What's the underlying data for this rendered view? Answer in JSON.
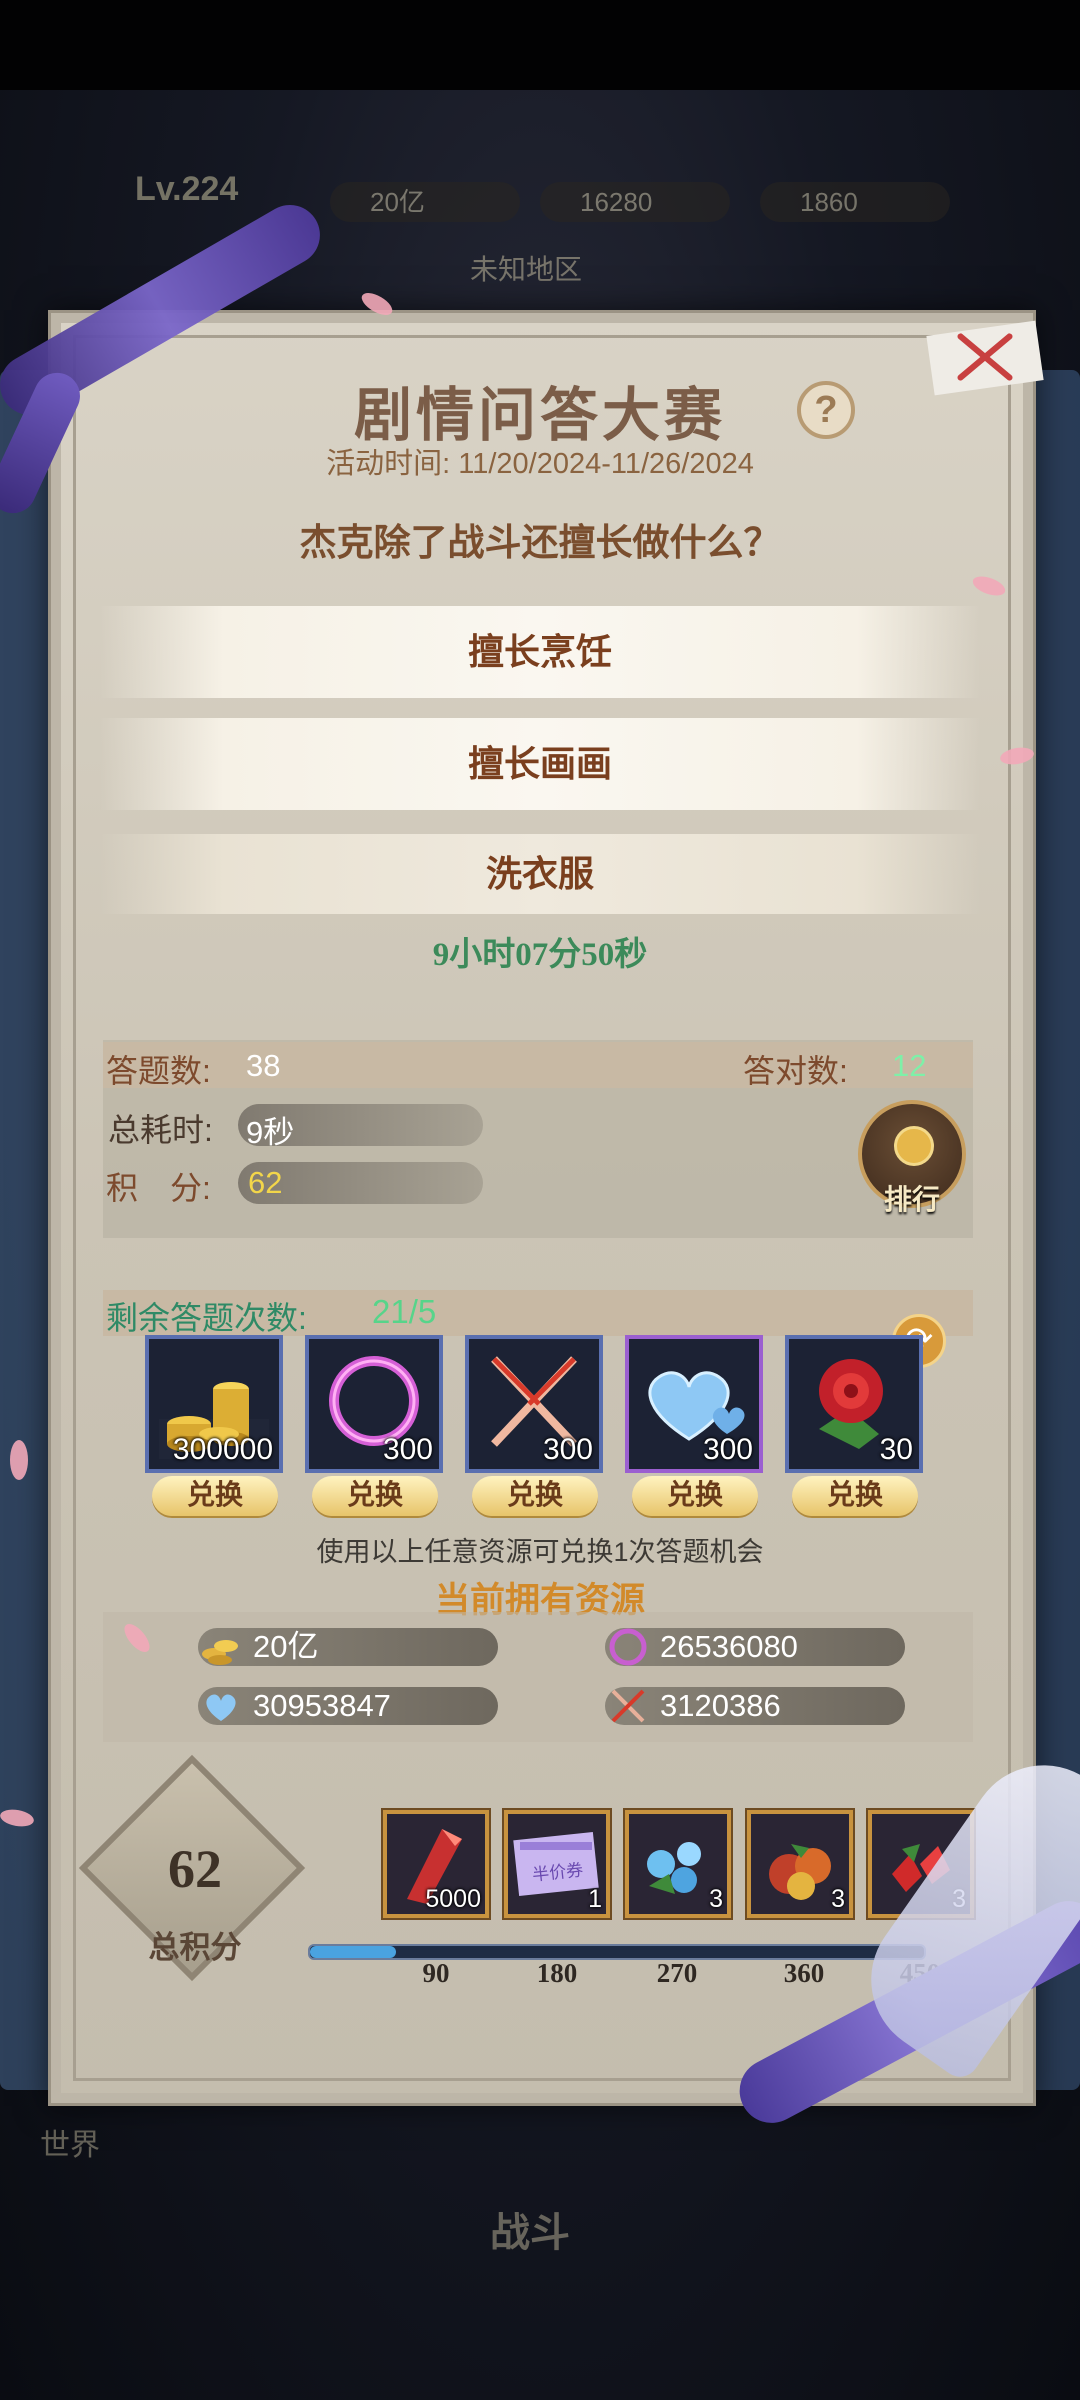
{
  "background_hud": {
    "level": "Lv.224",
    "gold": "20亿",
    "diamond": "16280",
    "energy": "1860",
    "area": "未知地区",
    "chat_tab": "世界",
    "bottom_center": "战斗"
  },
  "dialog": {
    "title": "剧情问答大赛",
    "help_symbol": "?",
    "activity_time": "活动时间: 11/20/2024-11/26/2024",
    "question": "杰克除了战斗还擅长做什么？",
    "options": [
      "擅长烹饪",
      "擅长画画",
      "洗衣服"
    ],
    "countdown": "9小时07分50秒"
  },
  "stats": {
    "answered_label": "答题数:",
    "answered_value": "38",
    "correct_label": "答对数:",
    "correct_value": "12",
    "time_label": "总耗时:",
    "time_value": "9秒",
    "score_label": "积　分:",
    "score_value": "62",
    "rank_label": "排行"
  },
  "remaining": {
    "label": "剩余答题次数:",
    "value": "21/5"
  },
  "exchange_items": [
    {
      "icon": "gold-coins-icon",
      "qty": "300000",
      "button": "兑换"
    },
    {
      "icon": "purple-ring-icon",
      "qty": "300",
      "button": "兑换"
    },
    {
      "icon": "crossed-swords-icon",
      "qty": "300",
      "button": "兑换"
    },
    {
      "icon": "blue-heart-crystal-icon",
      "qty": "300",
      "button": "兑换"
    },
    {
      "icon": "red-rose-icon",
      "qty": "30",
      "button": "兑换"
    }
  ],
  "exchange_hint": "使用以上任意资源可兑换1次答题机会",
  "resources_title": "当前拥有资源",
  "resources": [
    {
      "icon": "gold-coins-icon",
      "value": "20亿"
    },
    {
      "icon": "purple-ring-icon",
      "value": "26536080"
    },
    {
      "icon": "blue-heart-crystal-icon",
      "value": "30953847"
    },
    {
      "icon": "crossed-swords-icon",
      "value": "3120386"
    }
  ],
  "total": {
    "value": "62",
    "label": "总积分"
  },
  "rewards": [
    {
      "icon": "red-crystal-shard-icon",
      "qty": "5000",
      "milestone": "90"
    },
    {
      "icon": "half-price-coupon-icon",
      "qty": "1",
      "milestone": "180",
      "coupon_text": "半价券"
    },
    {
      "icon": "blue-gem-bouquet-icon",
      "qty": "3",
      "milestone": "270"
    },
    {
      "icon": "berry-fruit-icon",
      "qty": "3",
      "milestone": "360"
    },
    {
      "icon": "red-gem-cluster-icon",
      "qty": "3",
      "milestone": "450"
    }
  ],
  "progress_fraction": 0.14,
  "colors": {
    "correct_green": "#3c8a5a",
    "score_yellow": "#f2d64a",
    "answer_brown": "#7a3f1e",
    "resource_title_orange": "#d28a2a"
  }
}
